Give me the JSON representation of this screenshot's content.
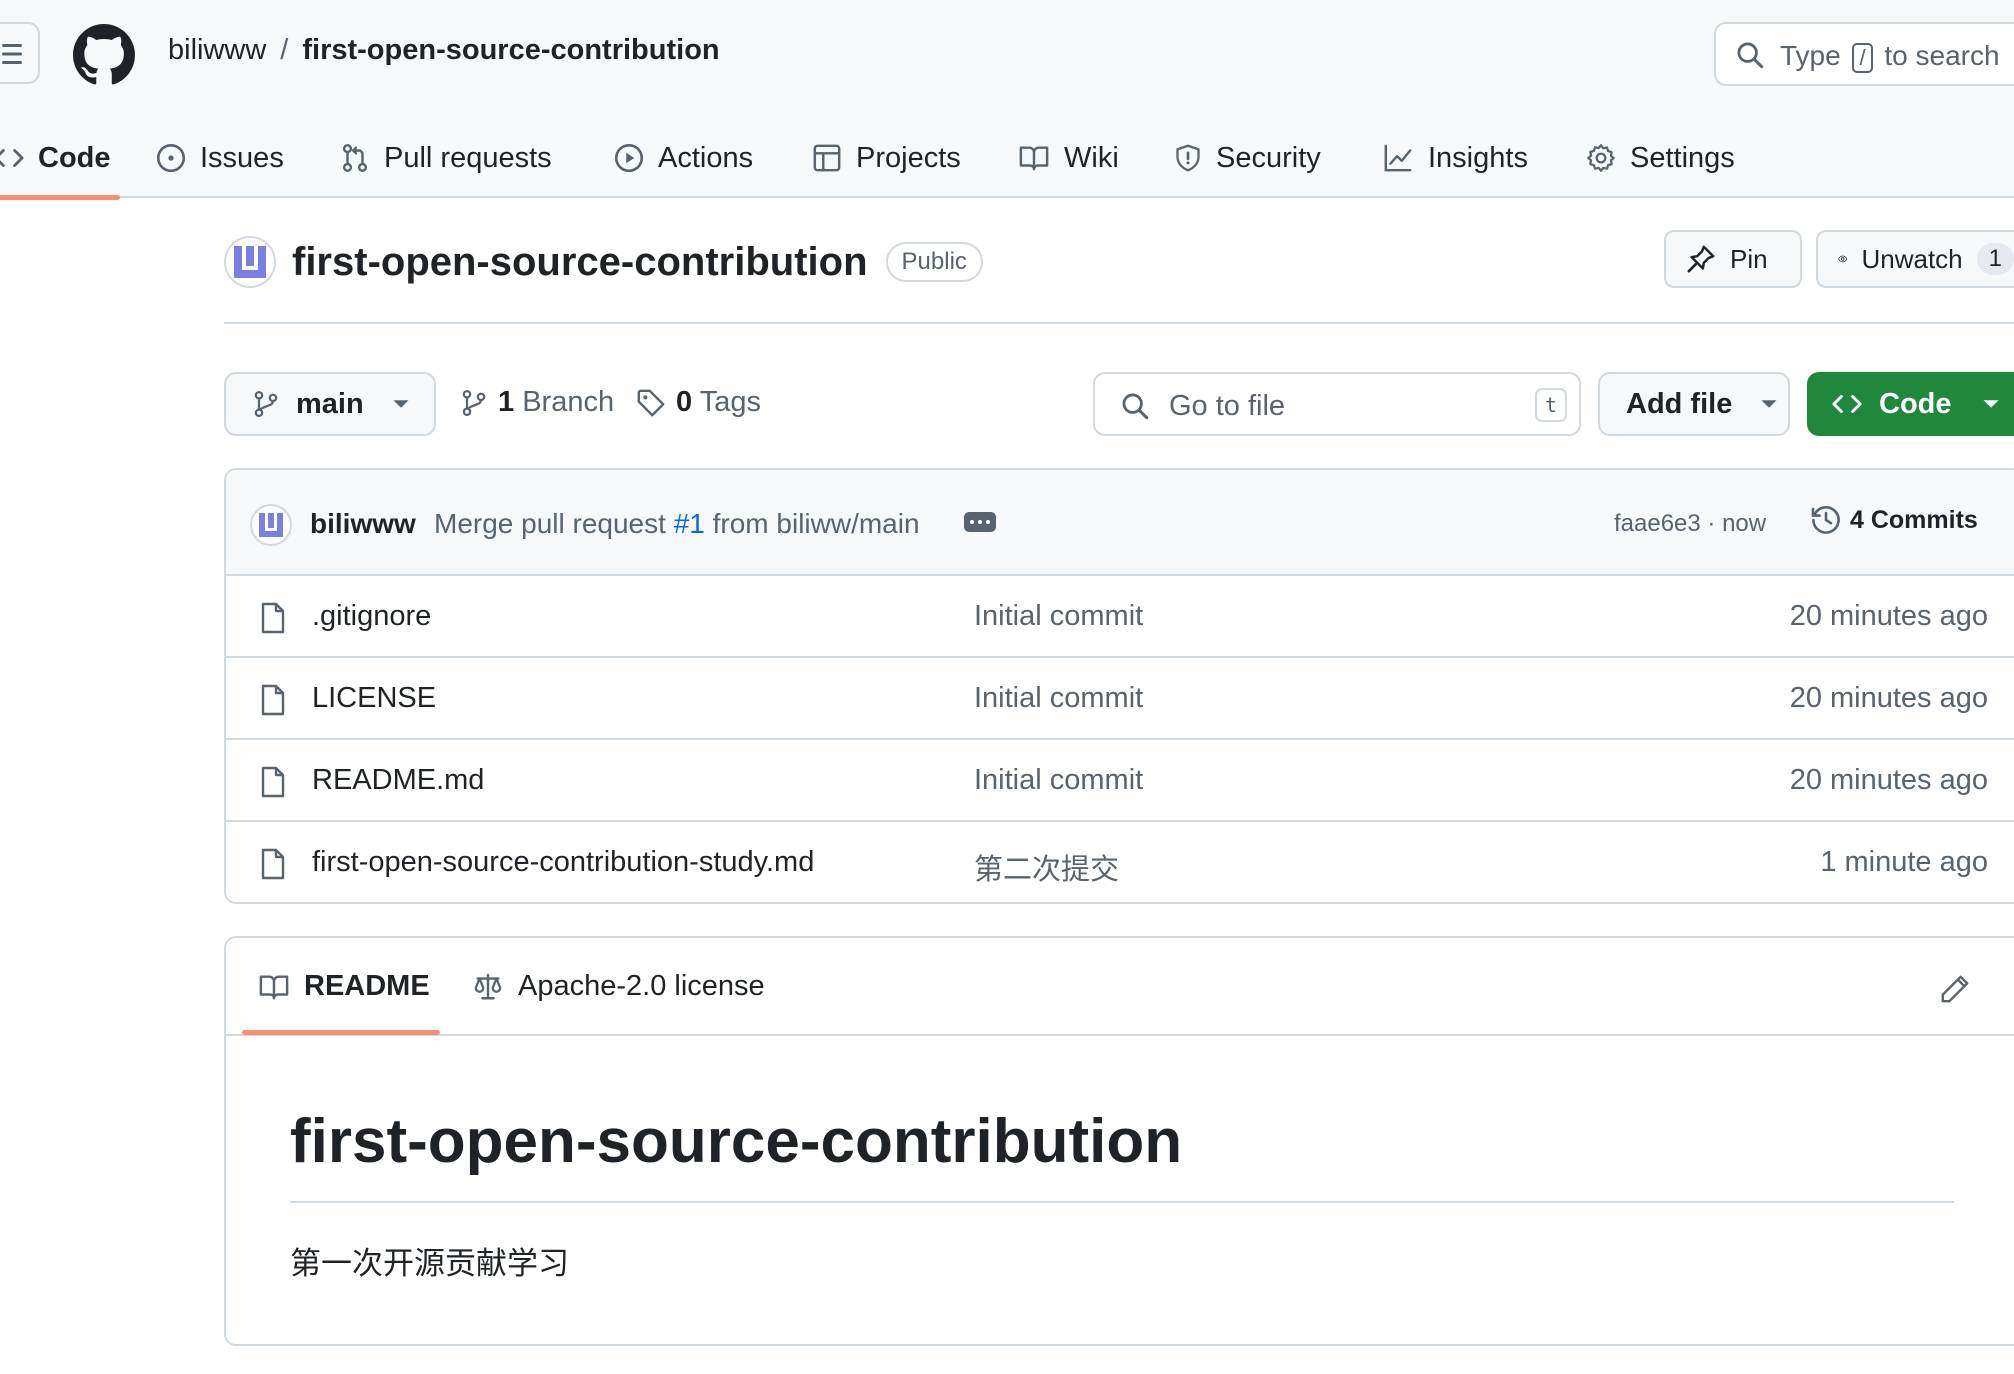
{
  "header": {
    "owner": "biliwww",
    "separator": "/",
    "repo": "first-open-source-contribution",
    "search_prefix": "Type",
    "search_key": "/",
    "search_suffix": "to search"
  },
  "nav": {
    "items": [
      {
        "label": "Code",
        "icon": "code-icon",
        "active": true
      },
      {
        "label": "Issues",
        "icon": "issue-icon"
      },
      {
        "label": "Pull requests",
        "icon": "pull-request-icon"
      },
      {
        "label": "Actions",
        "icon": "play-icon"
      },
      {
        "label": "Projects",
        "icon": "table-icon"
      },
      {
        "label": "Wiki",
        "icon": "book-icon"
      },
      {
        "label": "Security",
        "icon": "shield-icon"
      },
      {
        "label": "Insights",
        "icon": "graph-icon"
      },
      {
        "label": "Settings",
        "icon": "gear-icon"
      }
    ]
  },
  "repo": {
    "title": "first-open-source-contribution",
    "visibility": "Public",
    "pin_label": "Pin",
    "unwatch_label": "Unwatch",
    "watch_count": "1"
  },
  "toolbar": {
    "branch": "main",
    "branch_count": "1",
    "branch_label": "Branch",
    "tag_count": "0",
    "tag_label": "Tags",
    "goto_placeholder": "Go to file",
    "goto_key": "t",
    "add_file": "Add file",
    "code_button": "Code"
  },
  "commit": {
    "author": "biliwww",
    "message_prefix": "Merge pull request",
    "pr_ref": "#1",
    "message_suffix": "from biliww/main",
    "hash_time": "faae6e3 · now",
    "commits_label": "4 Commits"
  },
  "files": [
    {
      "name": ".gitignore",
      "message": "Initial commit",
      "time": "20 minutes ago"
    },
    {
      "name": "LICENSE",
      "message": "Initial commit",
      "time": "20 minutes ago"
    },
    {
      "name": "README.md",
      "message": "Initial commit",
      "time": "20 minutes ago"
    },
    {
      "name": "first-open-source-contribution-study.md",
      "message": "第二次提交",
      "time": "1 minute ago"
    }
  ],
  "readme": {
    "tab_readme": "README",
    "tab_license": "Apache-2.0 license",
    "heading": "first-open-source-contribution",
    "body": "第一次开源贡献学习"
  },
  "colors": {
    "accent_underline": "#fd8c73",
    "primary_green": "#1f883d",
    "link_blue": "#0969da",
    "avatar_purple": "#7b7fe0"
  }
}
